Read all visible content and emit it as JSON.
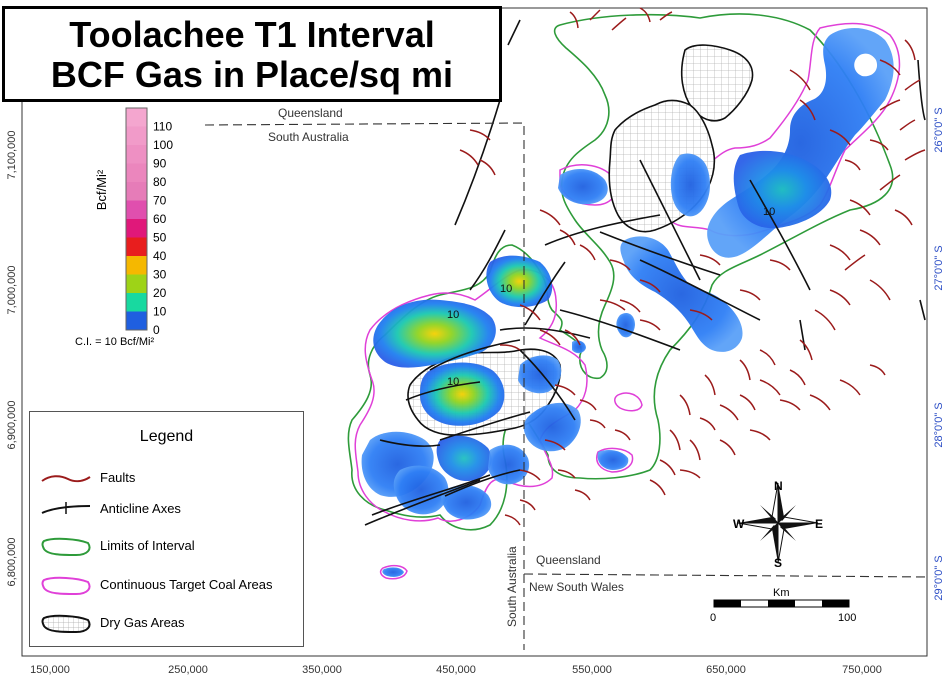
{
  "title": {
    "line1": "Toolachee T1 Interval",
    "line2": "BCF Gas in Place/sq mi"
  },
  "colorbar": {
    "unit_label": "Bcf/Mi²",
    "ticks": [
      "110",
      "100",
      "90",
      "80",
      "70",
      "60",
      "50",
      "40",
      "30",
      "20",
      "10",
      "0"
    ],
    "colors": [
      "#f4a6cf",
      "#f19bc9",
      "#ee90c3",
      "#eb86bd",
      "#e67cb8",
      "#e04fae",
      "#e0187a",
      "#e81e1e",
      "#f5b800",
      "#9ed317",
      "#18d9a0",
      "#1f5fe0"
    ],
    "contour_interval": "C.I. = 10 Bcf/Mi²"
  },
  "legend": {
    "title": "Legend",
    "items": [
      {
        "label": "Faults",
        "color": "#9b1b1b",
        "type": "fault"
      },
      {
        "label": "Anticline Axes",
        "color": "#111111",
        "type": "anticline"
      },
      {
        "label": "Limits of Interval",
        "color": "#2e9b3a",
        "type": "area"
      },
      {
        "label": "Continuous Target Coal Areas",
        "color": "#e040d8",
        "type": "area"
      },
      {
        "label": "Dry Gas Areas",
        "color": "#111111",
        "type": "area"
      }
    ]
  },
  "axes": {
    "x_ticks": [
      "150,000",
      "250,000",
      "350,000",
      "450,000",
      "550,000",
      "650,000",
      "750,000"
    ],
    "y_ticks": [
      "7,100,000",
      "7,000,000",
      "6,900,000",
      "6,800,000"
    ],
    "lat_ticks": [
      "26°0'0\" S",
      "27°0'0\" S",
      "28°0'0\" S",
      "29°0'0\" S"
    ]
  },
  "borders": {
    "qld_top": "Queensland",
    "sa_top": "South Australia",
    "qld_bottom": "Queensland",
    "nsw": "New South Wales",
    "sa_vertical": "South Australia"
  },
  "contour_labels": [
    "10",
    "10",
    "10",
    "10"
  ],
  "compass": {
    "n": "N",
    "s": "S",
    "e": "E",
    "w": "W"
  },
  "scalebar": {
    "unit": "Km",
    "min": "0",
    "max": "100"
  }
}
